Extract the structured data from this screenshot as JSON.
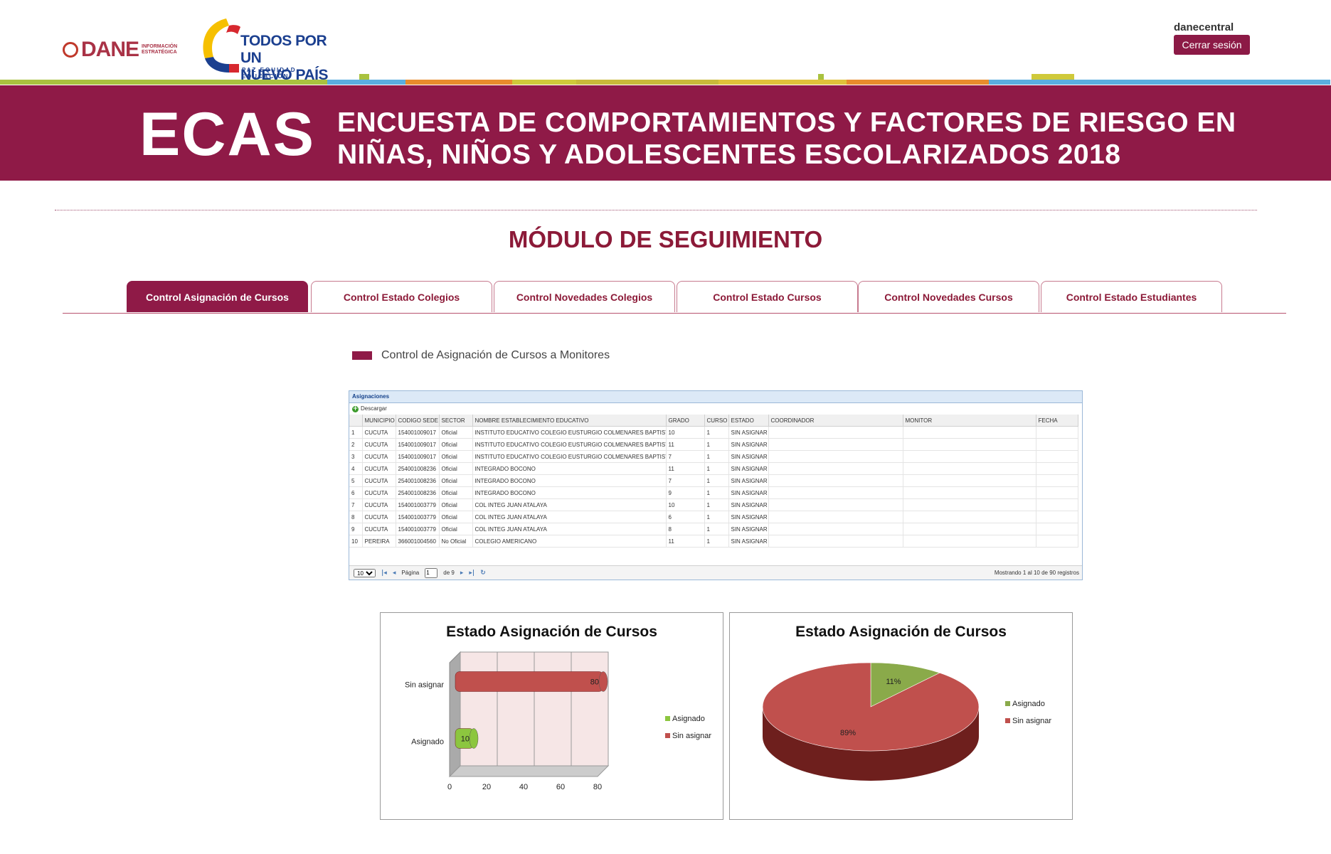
{
  "header": {
    "dane_logo_text": "DANE",
    "dane_logo_sub": "INFORMACIÓN ESTRATÉGICA",
    "tpn_logo_line1": "TODOS POR UN",
    "tpn_logo_line2": "NUEVO PAÍS",
    "tpn_logo_sub": "PAZ  EQUIDAD  EDUCACIÓN",
    "username": "danecentral",
    "logout_label": "Cerrar sesión"
  },
  "banner": {
    "acronym": "ECAS",
    "title_line1": "ENCUESTA DE COMPORTAMIENTOS Y FACTORES DE RIESGO EN",
    "title_line2": "NIÑAS, NIÑOS Y ADOLESCENTES ESCOLARIZADOS 2018"
  },
  "module_title": "MÓDULO DE SEGUIMIENTO",
  "tabs": [
    {
      "label": "Control Asignación de Cursos",
      "active": true
    },
    {
      "label": "Control Estado Colegios",
      "active": false
    },
    {
      "label": "Control Novedades Colegios",
      "active": false
    },
    {
      "label": "Control Estado Cursos",
      "active": false
    },
    {
      "label": "Control Novedades Cursos",
      "active": false
    },
    {
      "label": "Control Estado Estudiantes",
      "active": false
    }
  ],
  "section_title": "Control de Asignación de Cursos a Monitores",
  "grid": {
    "caption": "Asignaciones",
    "download_label": "Descargar",
    "columns": [
      "",
      "MUNICIPIO",
      "CODIGO SEDE",
      "SECTOR",
      "NOMBRE ESTABLECIMIENTO EDUCATIVO",
      "GRADO",
      "CURSO",
      "ESTADO",
      "COORDINADOR",
      "MONITOR",
      "FECHA"
    ],
    "rows": [
      [
        "1",
        "CUCUTA",
        "154001009017",
        "Oficial",
        "INSTITUTO EDUCATIVO COLEGIO EUSTURGIO COLMENARES BAPTISTA",
        "10",
        "1",
        "SIN ASIGNAR",
        "",
        "",
        ""
      ],
      [
        "2",
        "CUCUTA",
        "154001009017",
        "Oficial",
        "INSTITUTO EDUCATIVO COLEGIO EUSTURGIO COLMENARES BAPTISTA",
        "11",
        "1",
        "SIN ASIGNAR",
        "",
        "",
        ""
      ],
      [
        "3",
        "CUCUTA",
        "154001009017",
        "Oficial",
        "INSTITUTO EDUCATIVO COLEGIO EUSTURGIO COLMENARES BAPTISTA",
        "7",
        "1",
        "SIN ASIGNAR",
        "",
        "",
        ""
      ],
      [
        "4",
        "CUCUTA",
        "254001008236",
        "Oficial",
        "INTEGRADO BOCONO",
        "11",
        "1",
        "SIN ASIGNAR",
        "",
        "",
        ""
      ],
      [
        "5",
        "CUCUTA",
        "254001008236",
        "Oficial",
        "INTEGRADO BOCONO",
        "7",
        "1",
        "SIN ASIGNAR",
        "",
        "",
        ""
      ],
      [
        "6",
        "CUCUTA",
        "254001008236",
        "Oficial",
        "INTEGRADO BOCONO",
        "9",
        "1",
        "SIN ASIGNAR",
        "",
        "",
        ""
      ],
      [
        "7",
        "CUCUTA",
        "154001003779",
        "Oficial",
        "COL INTEG JUAN ATALAYA",
        "10",
        "1",
        "SIN ASIGNAR",
        "",
        "",
        ""
      ],
      [
        "8",
        "CUCUTA",
        "154001003779",
        "Oficial",
        "COL INTEG JUAN ATALAYA",
        "6",
        "1",
        "SIN ASIGNAR",
        "",
        "",
        ""
      ],
      [
        "9",
        "CUCUTA",
        "154001003779",
        "Oficial",
        "COL INTEG JUAN ATALAYA",
        "8",
        "1",
        "SIN ASIGNAR",
        "",
        "",
        ""
      ],
      [
        "10",
        "PEREIRA",
        "366001004560",
        "No Oficial",
        "COLEGIO AMERICANO",
        "11",
        "1",
        "SIN ASIGNAR",
        "",
        "",
        ""
      ]
    ],
    "pager": {
      "page_size": "10",
      "page_label": "Página",
      "page_value": "1",
      "of_label": "de 9",
      "info": "Mostrando 1 al 10 de 90 registros"
    }
  },
  "chart_data": [
    {
      "type": "bar",
      "title": "Estado Asignación de Cursos",
      "categories": [
        "Sin asignar",
        "Asignado"
      ],
      "series": [
        {
          "values": [
            80,
            10
          ]
        }
      ],
      "value_axis_ticks": [
        "0",
        "20",
        "40",
        "60",
        "80"
      ],
      "xlim": [
        0,
        80
      ],
      "legend": [
        "Asignado",
        "Sin asignar"
      ],
      "legend_position": "right",
      "colors": {
        "Asignado": "#8cc63f",
        "Sin asignar": "#c0504d"
      },
      "orientation": "horizontal",
      "grid": true
    },
    {
      "type": "pie",
      "title": "Estado Asignación de Cursos",
      "categories": [
        "Asignado",
        "Sin asignar"
      ],
      "values": [
        11,
        89
      ],
      "labels": [
        "11%",
        "89%"
      ],
      "legend": [
        "Asignado",
        "Sin asignar"
      ],
      "legend_position": "right",
      "colors": {
        "Asignado": "#8aaa4a",
        "Sin asignar": "#c0504d"
      }
    }
  ],
  "colors": {
    "brand": "#8f1a47",
    "title": "#8c1a38"
  }
}
